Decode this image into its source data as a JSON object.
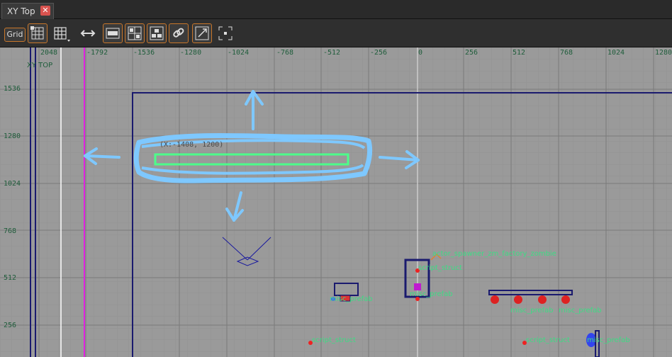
{
  "tab": {
    "title": "XY Top",
    "close_glyph": "✕"
  },
  "toolbar": {
    "grid_label": "Grid",
    "buttons": [
      {
        "name": "grid-snap-icon"
      },
      {
        "name": "grid-size-icon"
      },
      {
        "name": "stretch-icon"
      },
      {
        "name": "text-labels-icon"
      },
      {
        "name": "group-icon"
      },
      {
        "name": "prefab-icon"
      },
      {
        "name": "link-icon"
      },
      {
        "name": "scale-icon"
      },
      {
        "name": "center-icon"
      }
    ]
  },
  "viewport": {
    "view_title": "XY TOP",
    "x_ticks": [
      "2048",
      "-1792",
      "-1536",
      "-1280",
      "-1024",
      "-768",
      "-512",
      "-256",
      "0",
      "256",
      "512",
      "768",
      "1024",
      "1280"
    ],
    "y_ticks": [
      "1536",
      "1280",
      "1024",
      "768",
      "512",
      "256"
    ],
    "entities": [
      {
        "label": "actor_spawner_zm_factory_zombie"
      },
      {
        "label": "script_struct"
      },
      {
        "label": "misc_prefab"
      },
      {
        "label": "misc_prefab"
      },
      {
        "label": "misc_prefab"
      },
      {
        "label": "misc_prefab"
      },
      {
        "label": "script_struct"
      },
      {
        "label": "script_struct"
      },
      {
        "label": "misc_prefab"
      }
    ],
    "coord_readout": "(X:-1408, 1200)",
    "colors": {
      "grid_bg": "#9a9a9a",
      "brush_blue": "#1a1a6e",
      "entity_label": "#3ddc84",
      "annotation": "#7ec8ff",
      "selection": "#4cff8a",
      "bound_line": "#e020e0"
    }
  }
}
